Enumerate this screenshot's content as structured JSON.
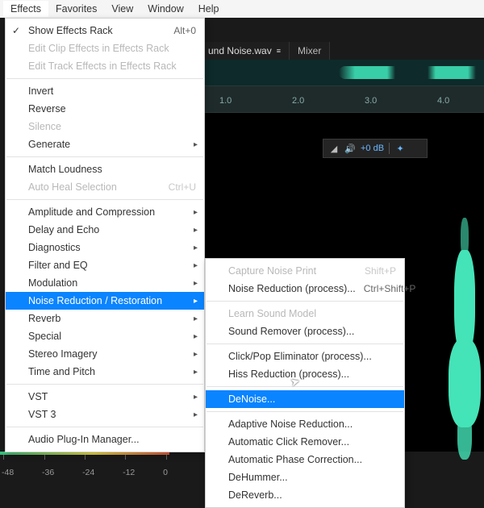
{
  "menubar": {
    "items": [
      {
        "label": "Effects",
        "open": true
      },
      {
        "label": "Favorites"
      },
      {
        "label": "View"
      },
      {
        "label": "Window"
      },
      {
        "label": "Help"
      }
    ]
  },
  "effects_menu": {
    "groups": [
      [
        {
          "label": "Show Effects Rack",
          "shortcut": "Alt+0",
          "checked": true
        },
        {
          "label": "Edit Clip Effects in Effects Rack",
          "disabled": true
        },
        {
          "label": "Edit Track Effects in Effects Rack",
          "disabled": true
        }
      ],
      [
        {
          "label": "Invert"
        },
        {
          "label": "Reverse"
        },
        {
          "label": "Silence",
          "disabled": true
        },
        {
          "label": "Generate",
          "submenu": true
        }
      ],
      [
        {
          "label": "Match Loudness"
        },
        {
          "label": "Auto Heal Selection",
          "shortcut": "Ctrl+U",
          "disabled": true
        }
      ],
      [
        {
          "label": "Amplitude and Compression",
          "submenu": true
        },
        {
          "label": "Delay and Echo",
          "submenu": true
        },
        {
          "label": "Diagnostics",
          "submenu": true
        },
        {
          "label": "Filter and EQ",
          "submenu": true
        },
        {
          "label": "Modulation",
          "submenu": true
        },
        {
          "label": "Noise Reduction / Restoration",
          "submenu": true,
          "selected": true
        },
        {
          "label": "Reverb",
          "submenu": true
        },
        {
          "label": "Special",
          "submenu": true
        },
        {
          "label": "Stereo Imagery",
          "submenu": true
        },
        {
          "label": "Time and Pitch",
          "submenu": true
        }
      ],
      [
        {
          "label": "VST",
          "submenu": true
        },
        {
          "label": "VST 3",
          "submenu": true
        }
      ],
      [
        {
          "label": "Audio Plug-In Manager..."
        }
      ]
    ]
  },
  "nr_submenu": {
    "groups": [
      [
        {
          "label": "Capture Noise Print",
          "shortcut": "Shift+P",
          "disabled": true
        },
        {
          "label": "Noise Reduction (process)...",
          "shortcut": "Ctrl+Shift+P"
        }
      ],
      [
        {
          "label": "Learn Sound Model",
          "disabled": true
        },
        {
          "label": "Sound Remover (process)..."
        }
      ],
      [
        {
          "label": "Click/Pop Eliminator (process)..."
        },
        {
          "label": "Hiss Reduction (process)..."
        }
      ],
      [
        {
          "label": "DeNoise...",
          "selected": true
        }
      ],
      [
        {
          "label": "Adaptive Noise Reduction..."
        },
        {
          "label": "Automatic Click Remover..."
        },
        {
          "label": "Automatic Phase Correction..."
        },
        {
          "label": "DeHummer..."
        },
        {
          "label": "DeReverb..."
        }
      ]
    ]
  },
  "tabs": {
    "file": {
      "label": "und Noise.wav",
      "modified_glyph": "≡"
    },
    "mixer": {
      "label": "Mixer"
    }
  },
  "ruler": {
    "t1": "1.0",
    "t2": "2.0",
    "t3": "3.0",
    "t4": "4.0"
  },
  "hud": {
    "gain": "+0 dB"
  },
  "meter": {
    "labels": [
      "-48",
      "-36",
      "-24",
      "-12",
      "0"
    ]
  }
}
